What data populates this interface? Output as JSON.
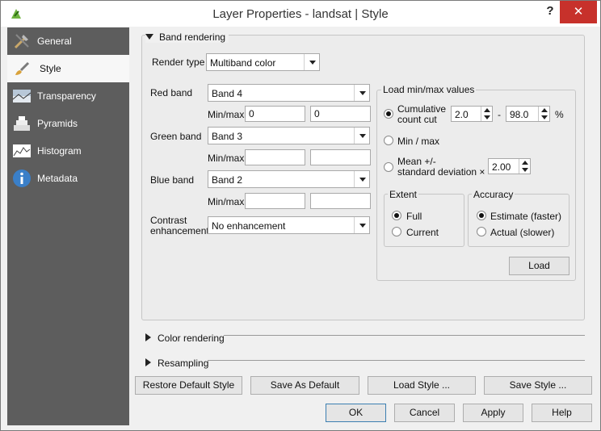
{
  "window": {
    "title": "Layer Properties - landsat | Style",
    "help": "?",
    "close": "✕"
  },
  "sidebar": {
    "items": [
      {
        "label": "General",
        "icon": "tools-icon"
      },
      {
        "label": "Style",
        "icon": "paintbrush-icon"
      },
      {
        "label": "Transparency",
        "icon": "transparency-icon"
      },
      {
        "label": "Pyramids",
        "icon": "pyramids-icon"
      },
      {
        "label": "Histogram",
        "icon": "histogram-icon"
      },
      {
        "label": "Metadata",
        "icon": "info-icon"
      }
    ]
  },
  "band_rendering": {
    "header": "Band rendering",
    "render_type_label": "Render type",
    "render_type_value": "Multiband color",
    "red_label": "Red band",
    "red_value": "Band 4",
    "green_label": "Green band",
    "green_value": "Band 3",
    "blue_label": "Blue band",
    "blue_value": "Band 2",
    "minmax_label": "Min/max",
    "red_min": "0",
    "red_max": "0",
    "green_min": "",
    "green_max": "",
    "blue_min": "",
    "blue_max": "",
    "contrast_label_1": "Contrast",
    "contrast_label_2": "enhancement",
    "contrast_value": "No enhancement"
  },
  "load_minmax": {
    "title": "Load min/max values",
    "cumulative_1": "Cumulative",
    "cumulative_2": "count cut",
    "cum_low": "2.0",
    "dash": "-",
    "cum_high": "98.0",
    "percent": "%",
    "minmax": "Min / max",
    "mean_1": "Mean +/-",
    "mean_2": "standard deviation ×",
    "stddev": "2.00",
    "extent_title": "Extent",
    "extent_full": "Full",
    "extent_current": "Current",
    "accuracy_title": "Accuracy",
    "accuracy_estimate": "Estimate (faster)",
    "accuracy_actual": "Actual (slower)",
    "load_button": "Load"
  },
  "sections": {
    "color_rendering": "Color rendering",
    "resampling": "Resampling"
  },
  "style_buttons": {
    "restore": "Restore Default Style",
    "save_default": "Save As Default",
    "load_style": "Load Style ...",
    "save_style": "Save Style ..."
  },
  "dialog_buttons": {
    "ok": "OK",
    "cancel": "Cancel",
    "apply": "Apply",
    "help": "Help"
  },
  "colors": {
    "sidebar_bg": "#5d5d5d",
    "close_red": "#c7312b"
  }
}
